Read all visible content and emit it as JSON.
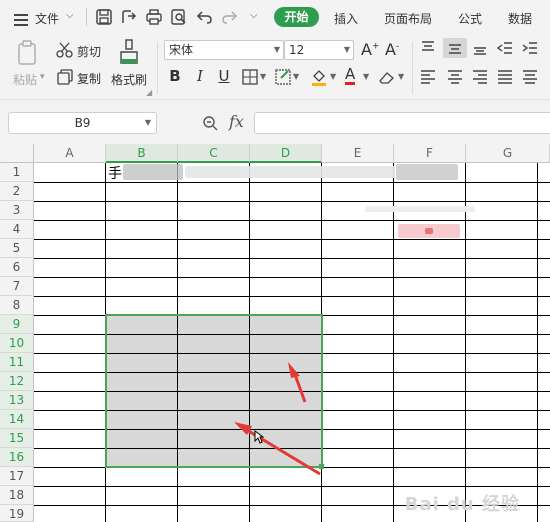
{
  "menubar": {
    "file_label": "文件",
    "tabs": [
      "开始",
      "插入",
      "页面布局",
      "公式",
      "数据"
    ]
  },
  "ribbon": {
    "paste_label": "粘贴",
    "cut_label": "剪切",
    "copy_label": "复制",
    "format_painter_label": "格式刷",
    "font_name": "宋体",
    "font_size": "12"
  },
  "formula_bar": {
    "name_box": "B9",
    "fx_label": "fx",
    "formula": ""
  },
  "sheet": {
    "columns": [
      "A",
      "B",
      "C",
      "D",
      "E",
      "F",
      "G"
    ],
    "selected_columns": [
      "B",
      "C",
      "D"
    ],
    "rows": [
      "1",
      "2",
      "3",
      "4",
      "5",
      "6",
      "7",
      "8",
      "9",
      "10",
      "11",
      "12",
      "13",
      "14",
      "15",
      "16",
      "17",
      "18",
      "19"
    ],
    "selected_rows": [
      "9",
      "10",
      "11",
      "12",
      "13",
      "14",
      "15",
      "16"
    ],
    "b1_text": "手",
    "selection_range": "B9:D16",
    "accent_color": "#4ca35c",
    "annotation_color": "#e53935"
  },
  "watermark": "Bai du 经验"
}
